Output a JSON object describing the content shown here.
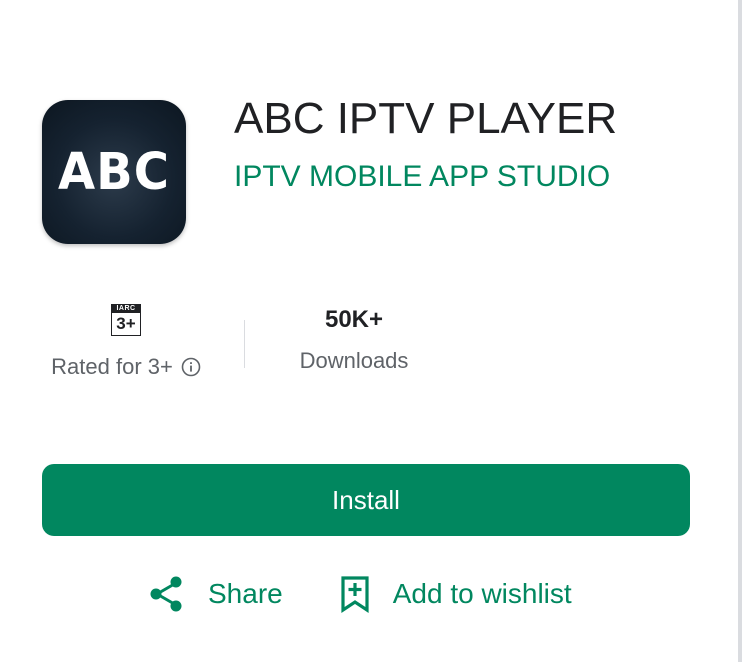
{
  "app": {
    "icon_text": "ABC",
    "title": "ABC IPTV PLAYER",
    "developer": "IPTV MOBILE APP STUDIO"
  },
  "stats": {
    "rating_badge_top": "IARC",
    "rating_badge_value": "3+",
    "rating_label": "Rated for 3+",
    "downloads_value": "50K+",
    "downloads_label": "Downloads"
  },
  "actions": {
    "install_label": "Install",
    "share_label": "Share",
    "wishlist_label": "Add to wishlist"
  },
  "icons": {
    "info": "info-icon",
    "share": "share-icon",
    "wishlist": "bookmark-add-icon"
  },
  "colors": {
    "accent": "#01875f",
    "title": "#202124",
    "secondary_text": "#5f6368",
    "icon_bg": "#152230"
  }
}
